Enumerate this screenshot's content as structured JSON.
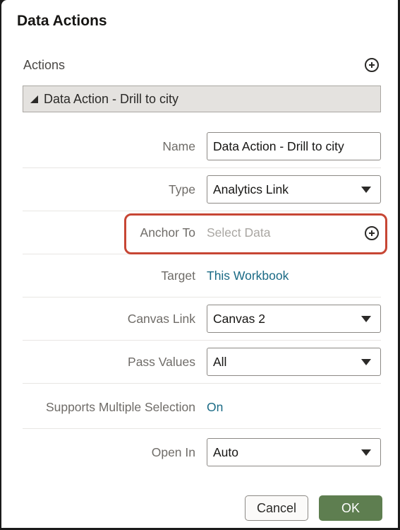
{
  "dialog": {
    "title": "Data Actions",
    "actions_label": "Actions",
    "add_action_icon": "plus-circle-icon",
    "action_header": "Data Action - Drill to city"
  },
  "form": {
    "name": {
      "label": "Name",
      "value": "Data Action - Drill to city"
    },
    "type": {
      "label": "Type",
      "value": "Analytics Link"
    },
    "anchor_to": {
      "label": "Anchor To",
      "placeholder": "Select Data",
      "icon": "plus-circle-icon"
    },
    "target": {
      "label": "Target",
      "value": "This Workbook"
    },
    "canvas_link": {
      "label": "Canvas Link",
      "value": "Canvas 2"
    },
    "pass_values": {
      "label": "Pass Values",
      "value": "All"
    },
    "multi_select": {
      "label": "Supports Multiple Selection",
      "value": "On"
    },
    "open_in": {
      "label": "Open In",
      "value": "Auto"
    }
  },
  "buttons": {
    "cancel": "Cancel",
    "ok": "OK"
  },
  "colors": {
    "link": "#1a6a85",
    "highlight": "#c74634",
    "ok_button": "#5e7e50",
    "section_header_bg": "#e4e2df"
  }
}
